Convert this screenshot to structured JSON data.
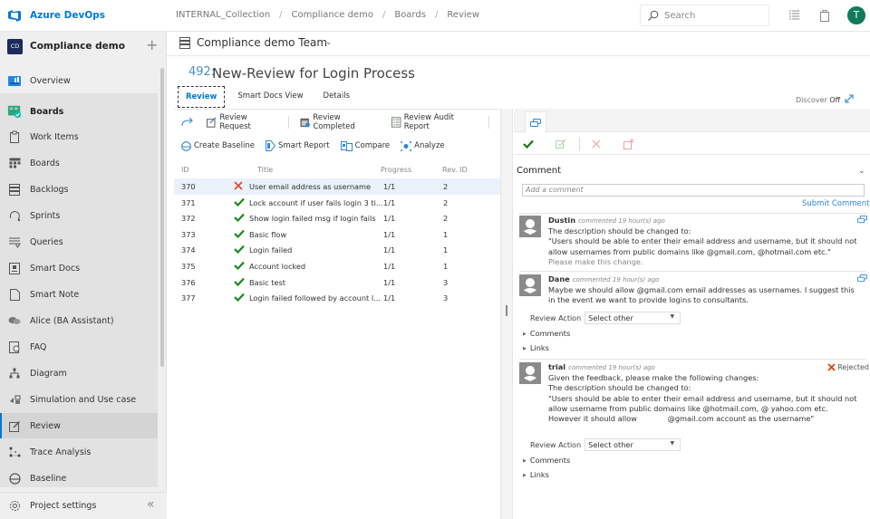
{
  "app": {
    "brand": "Azure DevOps",
    "breadcrumb": [
      "INTERNAL_Collection",
      "Compliance demo",
      "Boards",
      "Review"
    ],
    "search_placeholder": "Search",
    "user_initial": "T",
    "colors": {
      "accent": "#0078d4",
      "avatar": "#0e7a5a",
      "success": "#107c10",
      "error": "#e81123"
    }
  },
  "sidebar": {
    "project_badge": "CD",
    "project_name": "Compliance demo",
    "items": [
      {
        "label": "Overview",
        "icon": "overview-icon"
      },
      {
        "label": "Boards",
        "icon": "boards-hub-icon"
      },
      {
        "label": "Work Items",
        "icon": "work-items-icon"
      },
      {
        "label": "Boards",
        "icon": "boards-icon"
      },
      {
        "label": "Backlogs",
        "icon": "backlogs-icon"
      },
      {
        "label": "Sprints",
        "icon": "sprints-icon"
      },
      {
        "label": "Queries",
        "icon": "queries-icon"
      },
      {
        "label": "Smart Docs",
        "icon": "smart-docs-icon"
      },
      {
        "label": "Smart Note",
        "icon": "smart-note-icon"
      },
      {
        "label": "Alice (BA Assistant)",
        "icon": "chat-icon"
      },
      {
        "label": "FAQ",
        "icon": "faq-icon"
      },
      {
        "label": "Diagram",
        "icon": "diagram-icon"
      },
      {
        "label": "Simulation and Use case",
        "icon": "simulation-icon"
      },
      {
        "label": "Review",
        "icon": "review-icon",
        "active": true
      },
      {
        "label": "Trace Analysis",
        "icon": "trace-icon"
      },
      {
        "label": "Baseline",
        "icon": "baseline-icon"
      }
    ],
    "settings_label": "Project settings",
    "collapse_glyph": "«"
  },
  "team": {
    "name": "Compliance demo Team",
    "chevron": "⌄"
  },
  "work_item": {
    "id": "492:",
    "title": "New-Review for Login Process",
    "tabs": [
      "Review",
      "Smart Docs View",
      "Details"
    ],
    "active_tab": "Review",
    "discover_label": "Discover",
    "discover_value": "Off"
  },
  "toolbar": {
    "row1": [
      "Review Request",
      "Review Completed",
      "Review Audit Report"
    ],
    "row2": [
      "Create Baseline",
      "Smart Report",
      "Compare",
      "Analyze"
    ]
  },
  "grid": {
    "columns": [
      "ID",
      "Title",
      "Progress",
      "Rev. ID"
    ],
    "rows": [
      {
        "id": "370",
        "status": "rejected",
        "title": "User email address as username",
        "progress": "1/1",
        "rev": "2",
        "selected": true
      },
      {
        "id": "371",
        "status": "approved",
        "title": "Lock account if user fails login 3 ti...",
        "progress": "1/1",
        "rev": "2"
      },
      {
        "id": "372",
        "status": "approved",
        "title": "Show login failed msg if login fails",
        "progress": "1/1",
        "rev": "2"
      },
      {
        "id": "373",
        "status": "approved",
        "title": "Basic flow",
        "progress": "1/1",
        "rev": "1"
      },
      {
        "id": "374",
        "status": "approved",
        "title": "Login failed",
        "progress": "1/1",
        "rev": "1"
      },
      {
        "id": "375",
        "status": "approved",
        "title": "Account locked",
        "progress": "1/1",
        "rev": "1"
      },
      {
        "id": "376",
        "status": "approved",
        "title": "Basic test",
        "progress": "1/1",
        "rev": "3"
      },
      {
        "id": "377",
        "status": "approved",
        "title": "Login failed followed by account l...",
        "progress": "1/1",
        "rev": "3"
      }
    ]
  },
  "comments_panel": {
    "heading": "Comment",
    "input_placeholder": "Add a comment",
    "submit_label": "Submit Comment",
    "review_action_label": "Review Action",
    "review_action_value": "Select other",
    "comments_expander": "Comments",
    "links_expander": "Links",
    "rejected_label": "Rejected",
    "comments": [
      {
        "author": "Dustin",
        "meta": "commented 19 hour(s) ago",
        "lines": [
          "The description should be changed to:",
          "\"Users should be able to enter their email address and username, but it should not allow usernames from public domains like @gmail.com, @hotmail.com etc.\""
        ],
        "muted": "Please make this change."
      },
      {
        "author": "Dane",
        "meta": "commented 19 hour(s) ago",
        "lines": [
          "Maybe we should allow @gmail.com email addresses as usernames. I suggest this in the event we want to provide logins to consultants."
        ]
      },
      {
        "author": "trial",
        "meta": "commented 19 hour(s) ago",
        "lines": [
          "Given the feedback, please make the following changes:",
          "The description should be changed to:",
          "\"Users should be able to enter their email address and username, but it should not allow username from public domains like @hotmail.com, @ yahoo.com etc.",
          "However it should allow             @gmail.com account as the username\""
        ]
      }
    ]
  }
}
